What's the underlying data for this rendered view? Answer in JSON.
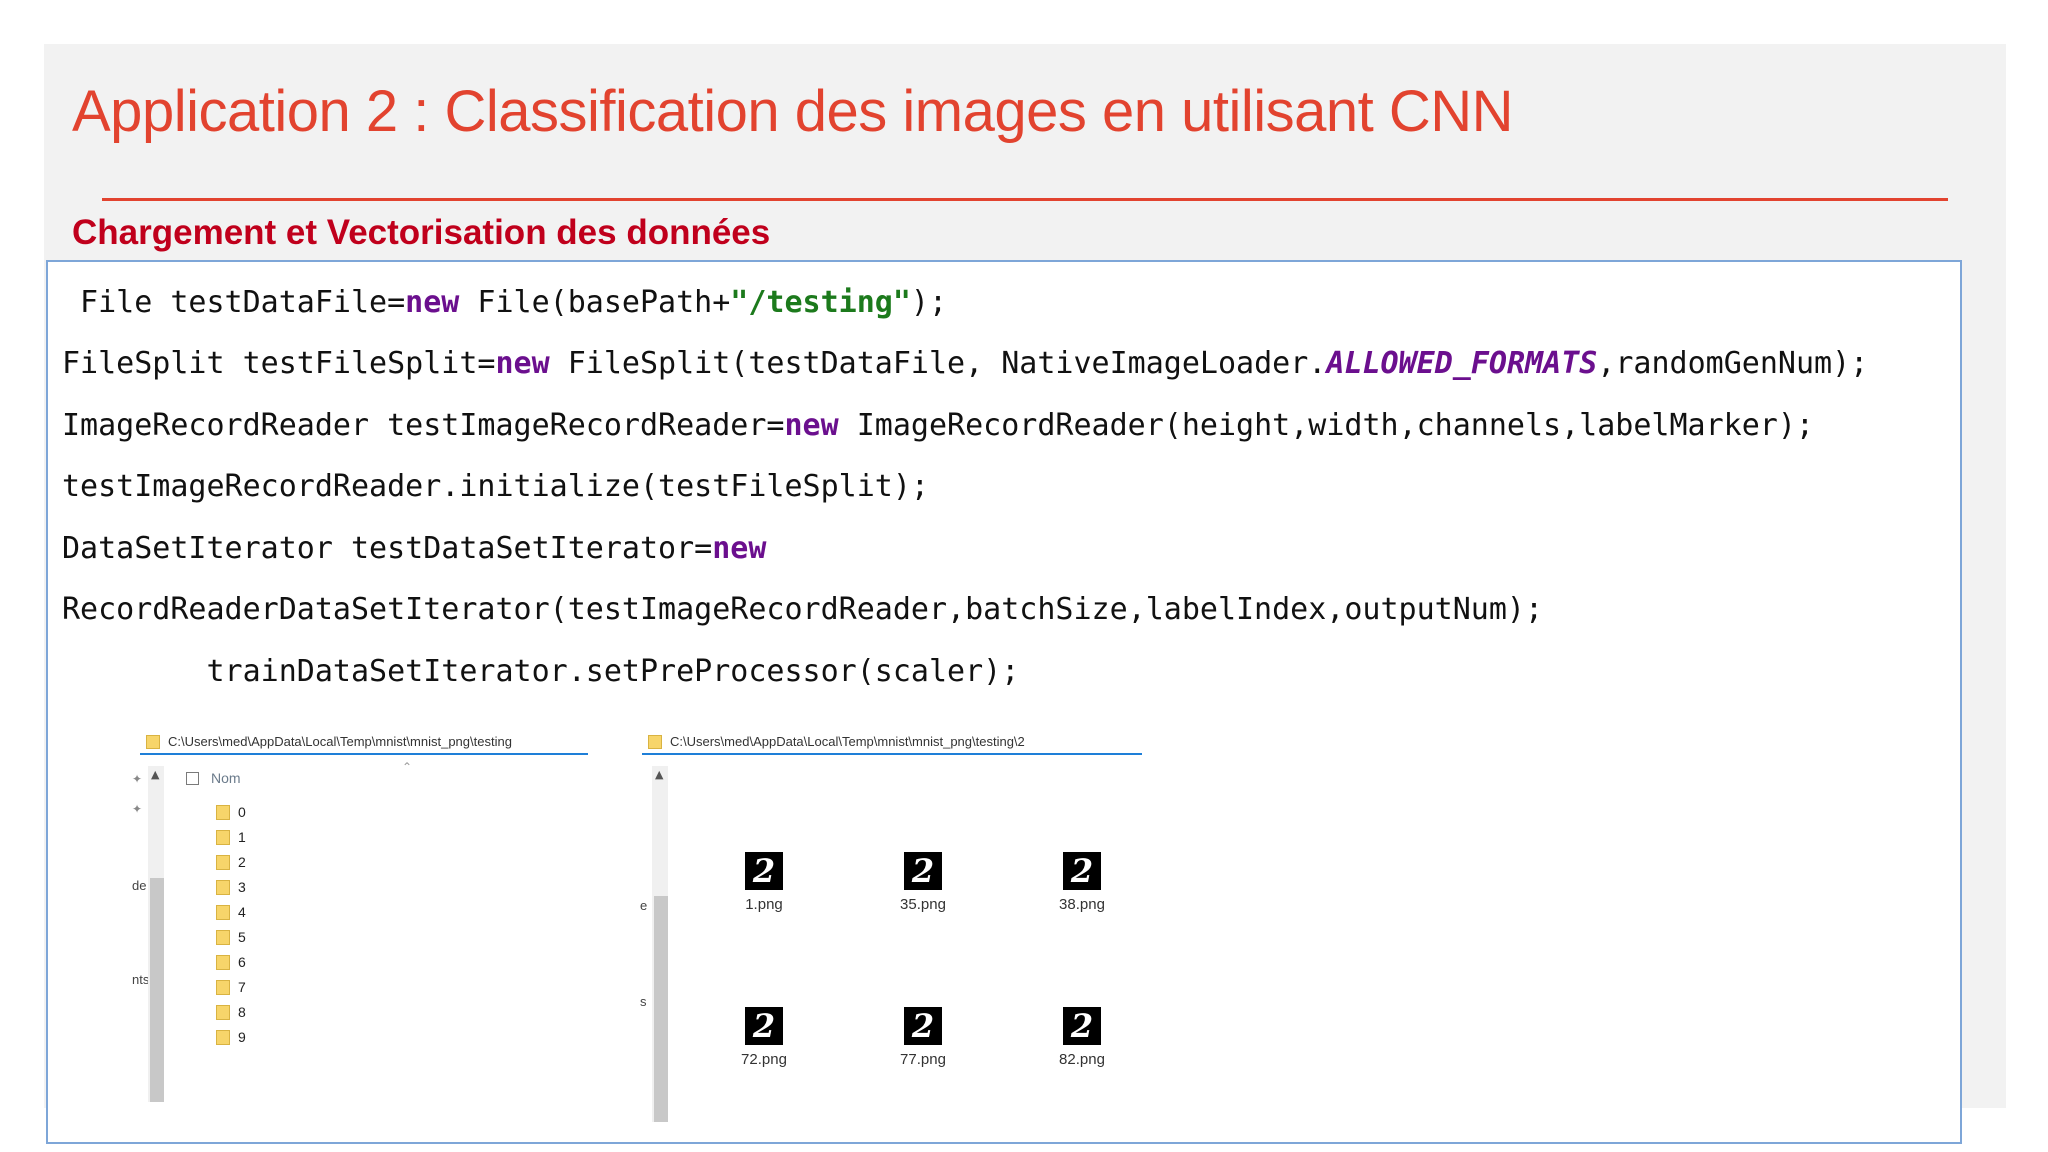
{
  "slide": {
    "title": "Application 2 : Classification des images en utilisant CNN",
    "subtitle": "Chargement et Vectorisation des données"
  },
  "code": {
    "line1": {
      "a": " File testDataFile=",
      "kw": "new",
      "b": " File(basePath+",
      "str": "\"/testing\"",
      "c": ");"
    },
    "line2": {
      "a": "FileSplit testFileSplit=",
      "kw": "new",
      "b": " FileSplit(testDataFile, NativeImageLoader.",
      "fld": "ALLOWED_FORMATS",
      "c": ",randomGenNum);"
    },
    "line3": {
      "a": "ImageRecordReader testImageRecordReader=",
      "kw": "new",
      "b": " ImageRecordReader(height,width,channels,labelMarker);"
    },
    "line4": {
      "a": "testImageRecordReader.initialize(testFileSplit);"
    },
    "line5": {
      "a": "DataSetIterator testDataSetIterator=",
      "kw": "new"
    },
    "line6": {
      "a": "RecordReaderDataSetIterator(testImageRecordReader,batchSize,labelIndex,outputNum);"
    },
    "line7": {
      "a": "        trainDataSetIterator.setPreProcessor(scaler);"
    }
  },
  "explorer_left": {
    "path": "C:\\Users\\med\\AppData\\Local\\Temp\\mnist\\mnist_png\\testing",
    "column_header": "Nom",
    "folders": [
      "0",
      "1",
      "2",
      "3",
      "4",
      "5",
      "6",
      "7",
      "8",
      "9"
    ],
    "side_fragments": [
      "de",
      "nts"
    ]
  },
  "explorer_right": {
    "path": "C:\\Users\\med\\AppData\\Local\\Temp\\mnist\\mnist_png\\testing\\2",
    "files": [
      {
        "name": "1.png",
        "glyph": "2"
      },
      {
        "name": "35.png",
        "glyph": "2"
      },
      {
        "name": "38.png",
        "glyph": "2"
      },
      {
        "name": "72.png",
        "glyph": "2"
      },
      {
        "name": "77.png",
        "glyph": "2"
      },
      {
        "name": "82.png",
        "glyph": "2"
      }
    ],
    "side_fragments": [
      "e",
      "s"
    ]
  },
  "colors": {
    "title": "#e2432f",
    "subtitle": "#c0001c",
    "keyword": "#6b0f8e",
    "string": "#1c7a1c",
    "border": "#7ea6d8"
  }
}
